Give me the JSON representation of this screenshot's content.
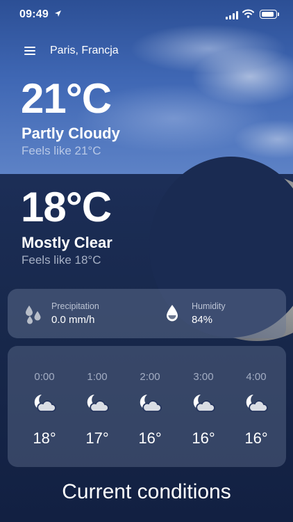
{
  "status_bar": {
    "time": "09:49",
    "location_icon": "location-arrow-icon",
    "signal_icon": "cellular-signal-icon",
    "wifi_icon": "wifi-icon",
    "battery_icon": "battery-icon",
    "battery_level": 0.9
  },
  "header": {
    "menu_icon": "hamburger-menu-icon",
    "location": "Paris, Francja"
  },
  "current_day": {
    "temperature": "21°C",
    "condition": "Partly Cloudy",
    "feels_like": "Feels like 21°C"
  },
  "current_night": {
    "temperature": "18°C",
    "condition": "Mostly Clear",
    "feels_like": "Feels like 18°C"
  },
  "details": {
    "precipitation": {
      "icon": "raindrops-icon",
      "label": "Precipitation",
      "value": "0.0 mm/h"
    },
    "humidity": {
      "icon": "humidity-drop-icon",
      "label": "Humidity",
      "value": "84%"
    }
  },
  "hourly": [
    {
      "time": "0:00",
      "icon": "moon-cloud-icon",
      "temp": "18°"
    },
    {
      "time": "1:00",
      "icon": "moon-cloud-icon",
      "temp": "17°"
    },
    {
      "time": "2:00",
      "icon": "moon-cloud-icon",
      "temp": "16°"
    },
    {
      "time": "3:00",
      "icon": "moon-cloud-icon",
      "temp": "16°"
    },
    {
      "time": "4:00",
      "icon": "moon-cloud-icon",
      "temp": "16°"
    }
  ],
  "section": {
    "title": "Current conditions"
  },
  "colors": {
    "sky_day": "#3f67b4",
    "sky_night": "#17274a",
    "card": "#69789a",
    "text": "#ffffff"
  }
}
